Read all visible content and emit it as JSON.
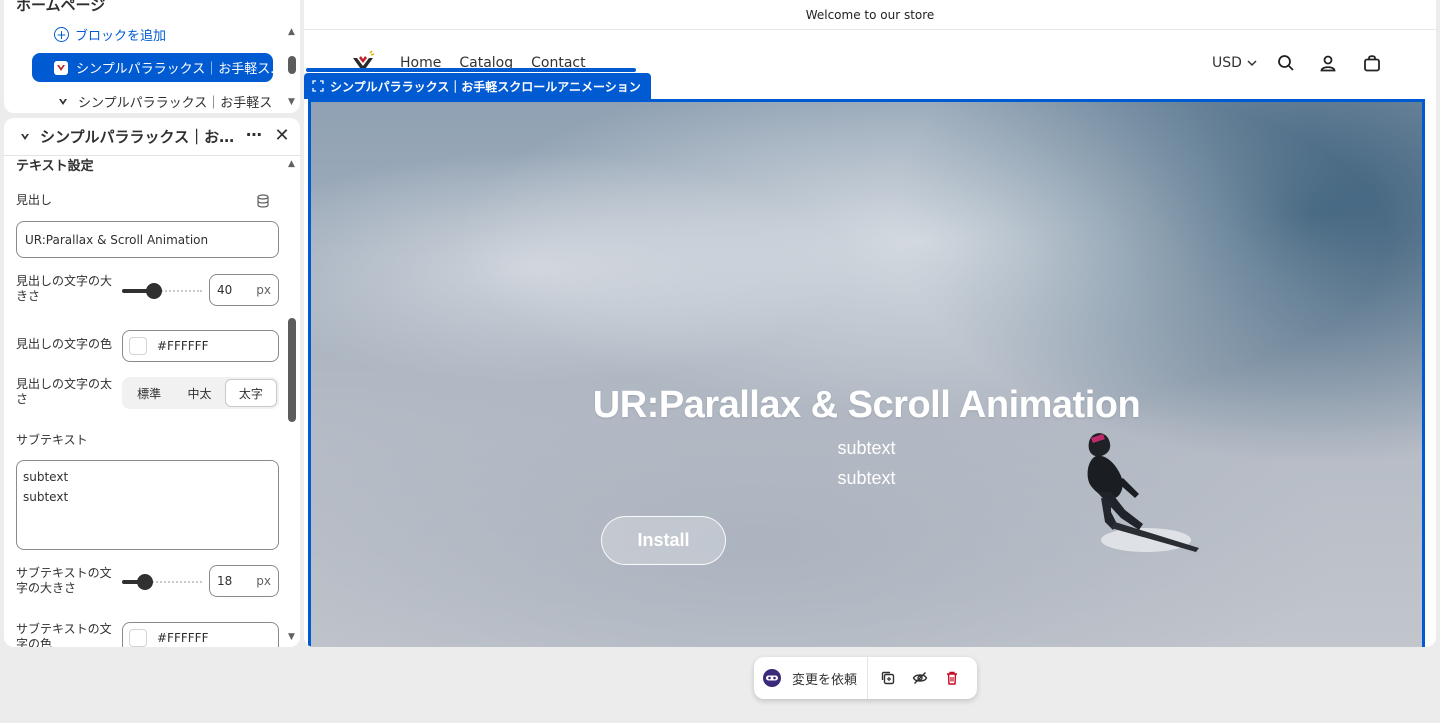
{
  "tree": {
    "title": "ホームページ",
    "add_block": "ブロックを追加",
    "items": [
      {
        "label": "シンプルパララックス｜お手軽ス..."
      },
      {
        "label": "シンプルパララックス｜お手軽ス..."
      }
    ]
  },
  "settings": {
    "header_title": "シンプルパララックス｜お手...",
    "more": "⋯",
    "close": "✕",
    "section_title": "テキスト設定",
    "heading_label": "見出し",
    "heading_value": "UR:Parallax & Scroll Animation",
    "heading_size_label": "見出しの文字の大きさ",
    "heading_size_value": "40",
    "heading_size_fraction": 0.35,
    "unit": "px",
    "heading_color_label": "見出しの文字の色",
    "heading_color_value": "#FFFFFF",
    "heading_weight_label": "見出しの文字の太さ",
    "weight_options": [
      "標準",
      "中太",
      "太字"
    ],
    "weight_selected": "太字",
    "subtext_label": "サブテキスト",
    "subtext_lines": [
      "subtext",
      "subtext"
    ],
    "subtext_size_label": "サブテキストの文字の大きさ",
    "subtext_size_value": "18",
    "subtext_size_fraction": 0.24,
    "subtext_color_label": "サブテキストの文字の色",
    "subtext_color_value": "#FFFFFF"
  },
  "store": {
    "announcement": "Welcome to our store",
    "nav": [
      "Home",
      "Catalog",
      "Contact"
    ],
    "currency": "USD",
    "section_tag": "シンプルパララックス｜お手軽スクロールアニメーション",
    "hero_heading": "UR:Parallax & Scroll Animation",
    "hero_sub": [
      "subtext",
      "subtext"
    ],
    "install_label": "Install"
  },
  "toolbar": {
    "request_label": "変更を依頼"
  },
  "colors": {
    "accent": "#005bd3",
    "delete": "#c70a24"
  }
}
